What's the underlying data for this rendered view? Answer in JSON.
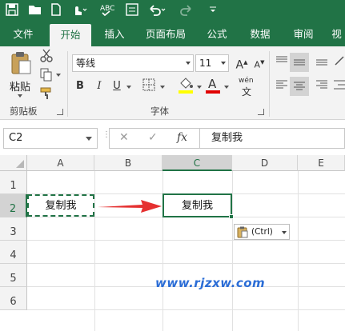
{
  "ribbon_tabs": [
    "文件",
    "开始",
    "插入",
    "页面布局",
    "公式",
    "数据",
    "审阅",
    "视"
  ],
  "active_tab": "开始",
  "clipboard": {
    "paste_label": "粘贴",
    "group_label": "剪贴板"
  },
  "font": {
    "name": "等线",
    "size": "11",
    "group_label": "字体",
    "bold": "B",
    "italic": "I",
    "underline": "U",
    "font_color_glyph": "A",
    "wen_glyph": "wén",
    "wen_sub": "文"
  },
  "formula_bar": {
    "name_box": "C2",
    "cancel": "✕",
    "enter": "✓",
    "fx": "fx",
    "formula": "复制我"
  },
  "columns": [
    "A",
    "B",
    "C",
    "D",
    "E"
  ],
  "rows": [
    "1",
    "2",
    "3",
    "4",
    "5",
    "6"
  ],
  "selected_column": "C",
  "selected_row": "2",
  "cells": {
    "A2": "复制我",
    "C2": "复制我"
  },
  "paste_options": "(Ctrl)",
  "watermark": "www.rjzxw.com",
  "colors": {
    "brand": "#217346",
    "arrow": "#e53030",
    "watermark": "#2b6dd6"
  }
}
